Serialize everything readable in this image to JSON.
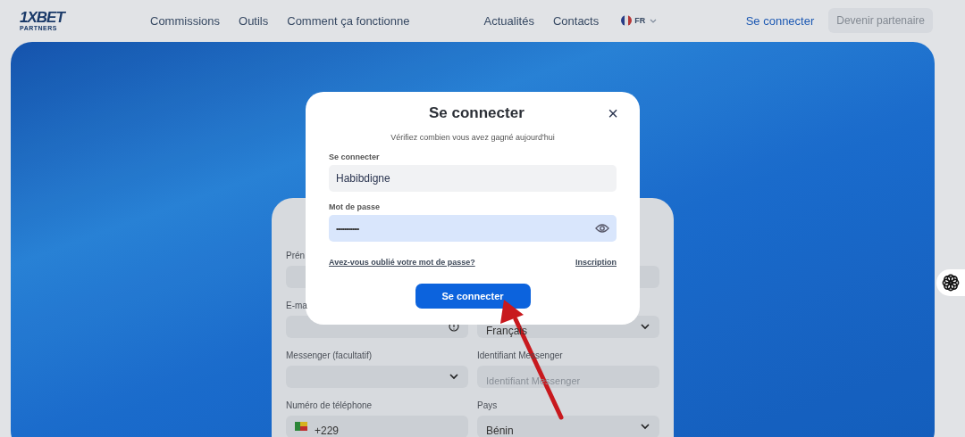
{
  "nav": {
    "logo": "1XBET",
    "logo_sub": "PARTNERS",
    "links": [
      "Commissions",
      "Outils",
      "Comment ça fonctionne",
      "Actualités",
      "Contacts"
    ],
    "language": "FR",
    "login": "Se connecter",
    "register": "Devenir partenaire"
  },
  "background_form": {
    "rows": [
      {
        "fields": [
          {
            "label": "Prén",
            "kind": "text"
          }
        ]
      },
      {
        "fields": [
          {
            "label": "E-ma",
            "kind": "info"
          },
          {
            "kind": "select",
            "value": "Français"
          }
        ]
      },
      {
        "fields": [
          {
            "label": "Messenger (facultatif)",
            "kind": "select"
          },
          {
            "label": "Identifiant Messenger",
            "kind": "text",
            "placeholder": "Identifiant Messenger"
          }
        ]
      },
      {
        "fields": [
          {
            "label": "Numéro de téléphone",
            "kind": "phone",
            "value": "+229"
          },
          {
            "label": "Pays",
            "kind": "select",
            "value": "Bénin"
          }
        ]
      }
    ]
  },
  "modal": {
    "title": "Se connecter",
    "close": "×",
    "subtitle": "Vérifiez combien vous avez gagné aujourd'hui",
    "fields": [
      {
        "label": "Se connecter",
        "value": "Habibdigne",
        "kind": "text",
        "autofilled": false
      },
      {
        "label": "Mot de passe",
        "value": "••••••••••••••",
        "kind": "password",
        "autofilled": true
      }
    ],
    "forgot_link": "Avez-vous oublié votre mot de passe?",
    "register_link": "Inscription",
    "submit": "Se connecter"
  }
}
